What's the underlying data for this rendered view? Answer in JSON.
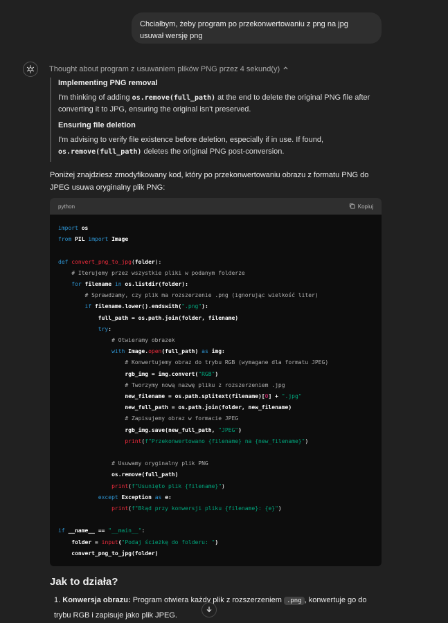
{
  "user_message": "Chciałbym, żeby program po przekonwertowaniu z png na jpg usuwał wersję png",
  "thought": {
    "header": "Thought about program z usuwaniem plików PNG przez 4 sekund(y)",
    "sections": [
      {
        "title": "Implementing PNG removal",
        "text_before": "I'm thinking of adding ",
        "code": "os.remove(full_path)",
        "text_after": " at the end to delete the original PNG file after converting it to JPG, ensuring the original isn't preserved."
      },
      {
        "title": "Ensuring file deletion",
        "text_before": "I'm advising to verify file existence before deletion, especially if in use. If found, ",
        "code": "os.remove(full_path)",
        "text_after": " deletes the original PNG post-conversion."
      }
    ]
  },
  "intro": "Poniżej znajdziesz zmodyfikowany kod, który po przekonwertowaniu obrazu z formatu PNG do JPEG usuwa oryginalny plik PNG:",
  "code_block": {
    "language": "python",
    "copy_label": "Kopiuj"
  },
  "how_it_works": {
    "title": "Jak to działa?",
    "item_number": "1.",
    "item_title": "Konwersja obrazu:",
    "item_text_before": " Program otwiera każdy plik z rozszerzeniem ",
    "item_code": ".png",
    "item_text_after": ", konwertuje go do trybu RGB i zapisuje jako plik JPEG."
  },
  "icons": {
    "assistant": "openai-logo-icon",
    "chevron": "chevron-up-icon",
    "copy": "copy-icon",
    "scroll_down": "arrow-down-icon"
  }
}
